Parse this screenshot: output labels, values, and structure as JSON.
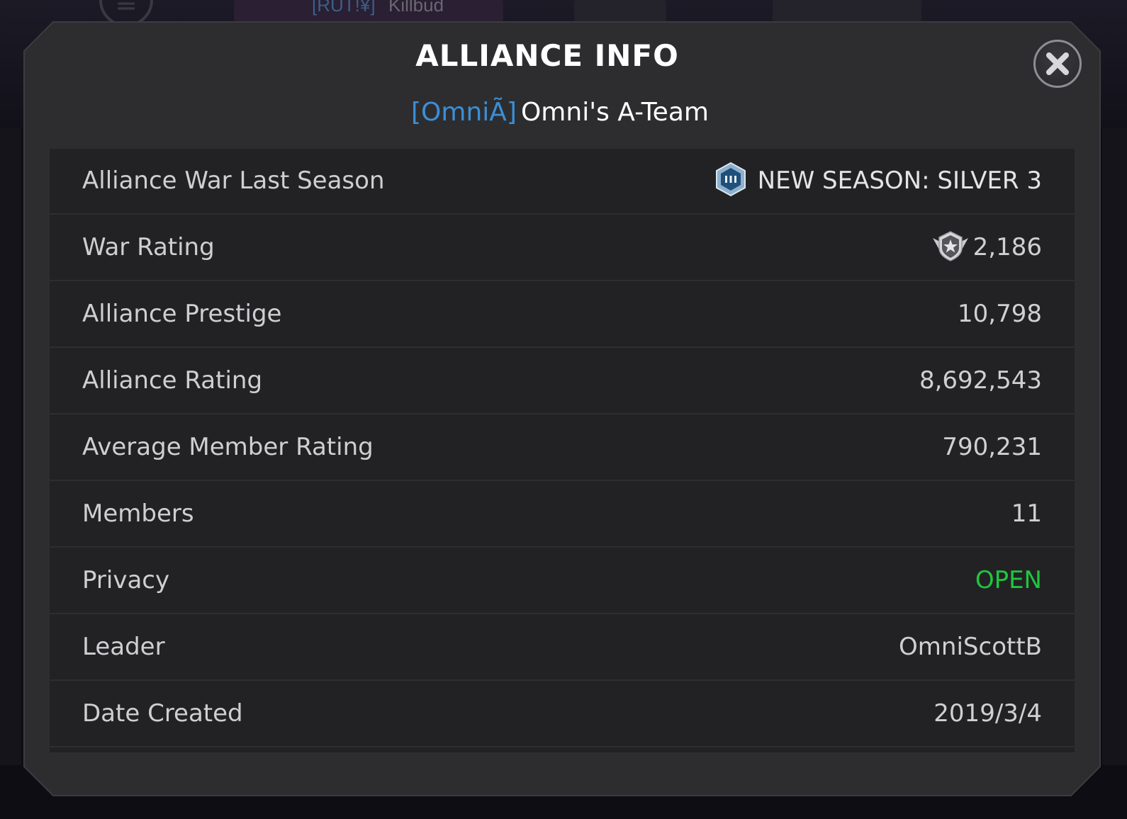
{
  "background": {
    "menu_icon": "menu-icon",
    "alliance_tag": "[RUT!¥]",
    "alliance_name": "Killbud"
  },
  "modal": {
    "title": "ALLIANCE INFO",
    "alliance_tag": "[OmniÃ]",
    "alliance_name": "Omni's A-Team",
    "close_icon": "close-icon",
    "colors": {
      "tag": "#3b8fd6",
      "open": "#1fc63c",
      "panel": "#2d2d30",
      "row": "#222225"
    }
  },
  "rows": [
    {
      "label": "Alliance War Last Season",
      "value": "NEW SEASON: SILVER 3",
      "icon": "silver-tier-badge-icon"
    },
    {
      "label": "War Rating",
      "value": "2,186",
      "icon": "war-rating-emblem-icon"
    },
    {
      "label": "Alliance Prestige",
      "value": "10,798"
    },
    {
      "label": "Alliance Rating",
      "value": "8,692,543"
    },
    {
      "label": "Average Member Rating",
      "value": "790,231"
    },
    {
      "label": "Members",
      "value": "11"
    },
    {
      "label": "Privacy",
      "value": "OPEN"
    },
    {
      "label": "Leader",
      "value": "OmniScottB"
    },
    {
      "label": "Date Created",
      "value": "2019/3/4"
    }
  ]
}
